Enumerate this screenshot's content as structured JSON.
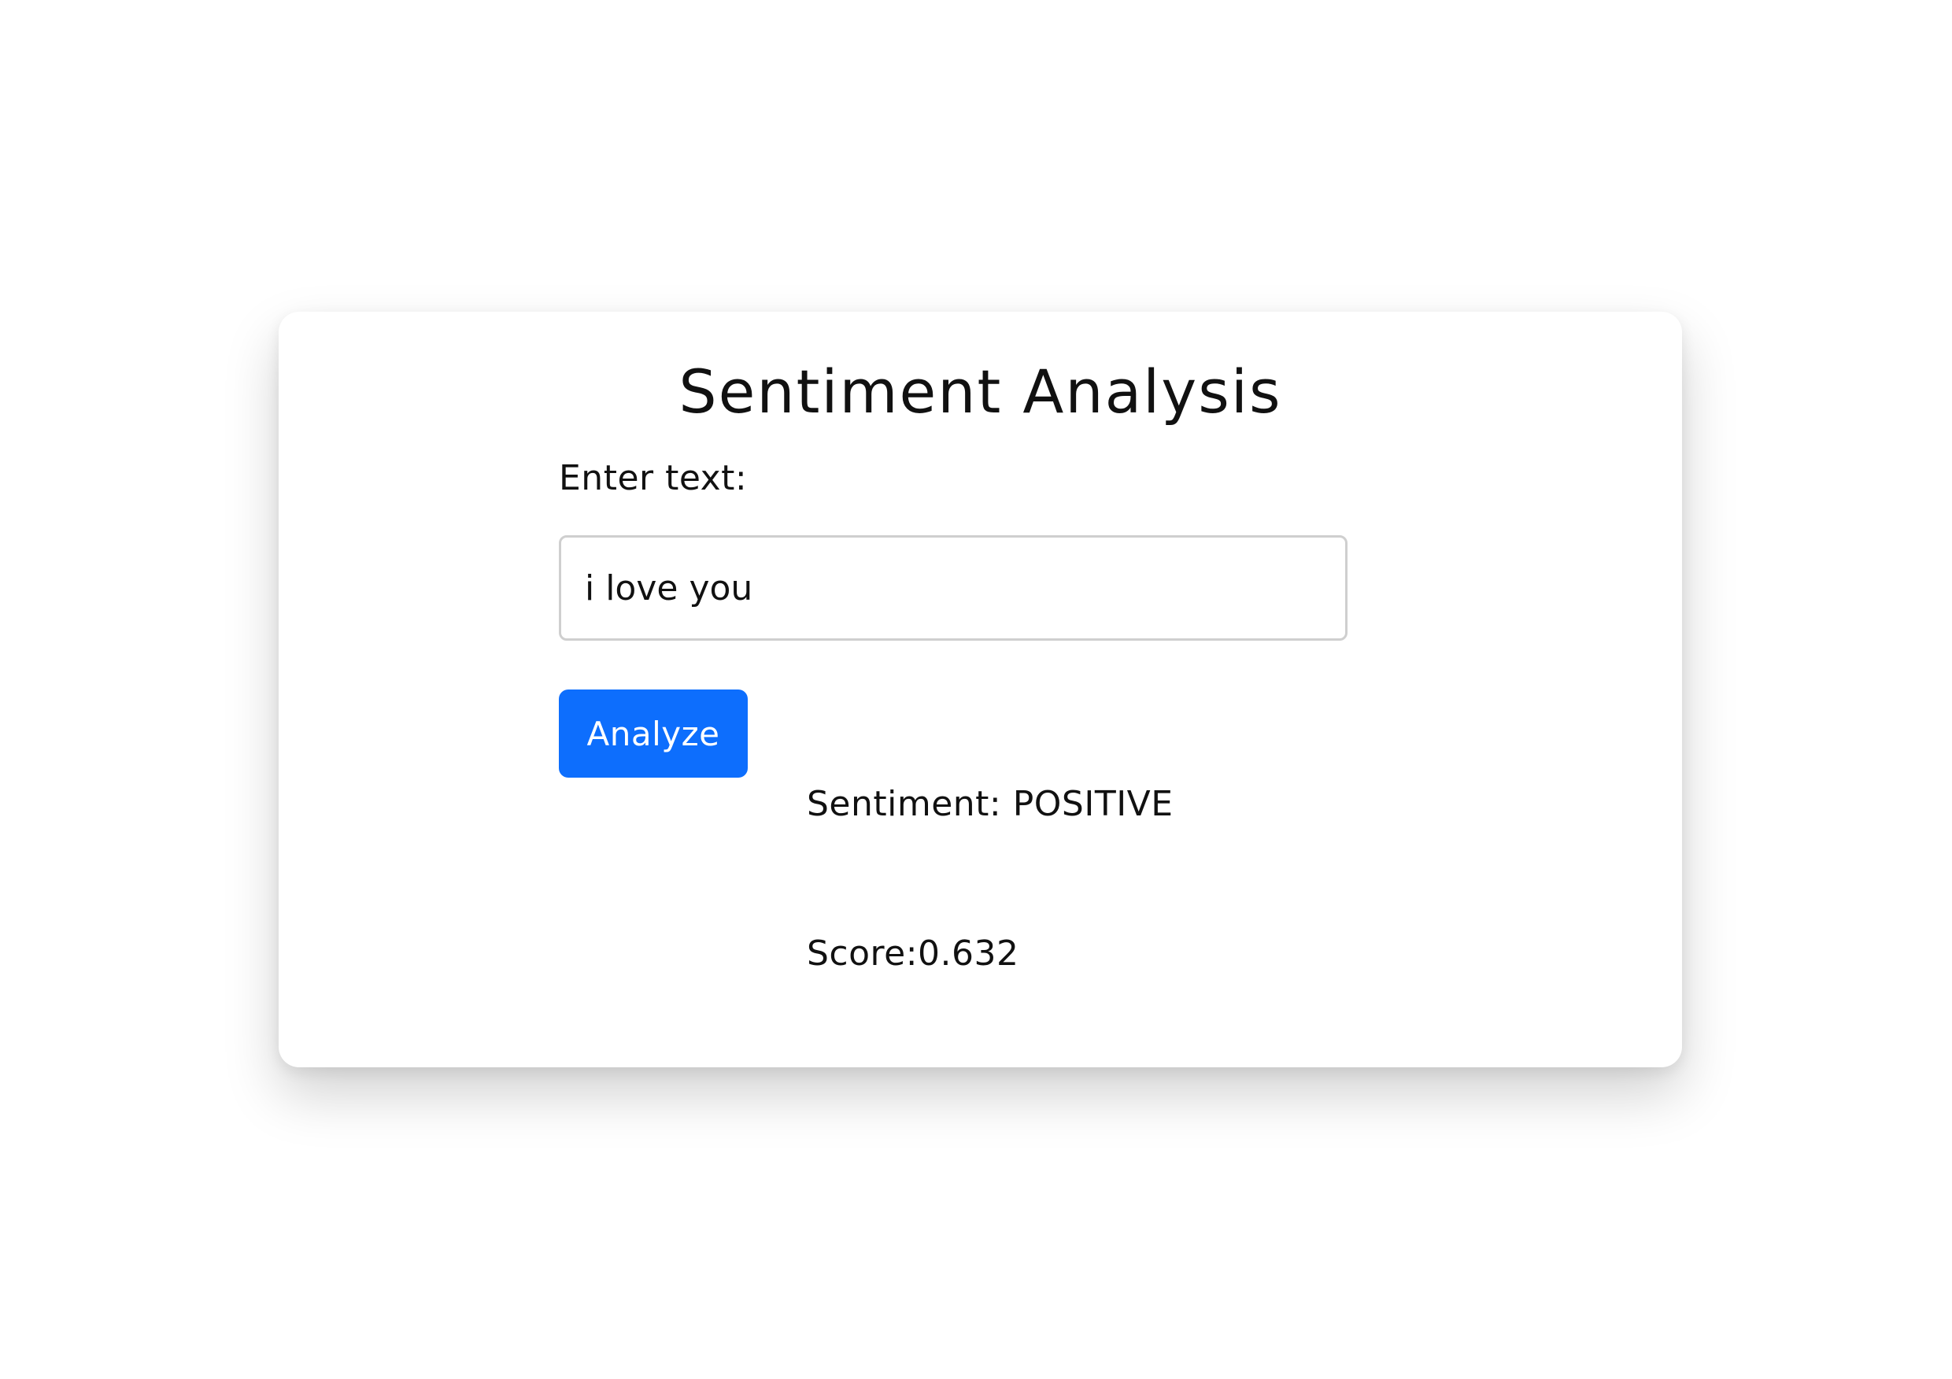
{
  "app": {
    "title": "Sentiment Analysis"
  },
  "form": {
    "label": "Enter text:",
    "input_value": "i love you",
    "submit_label": "Analyze"
  },
  "result": {
    "sentiment_text": "Sentiment: POSITIVE",
    "score_text": "Score:0.632"
  },
  "colors": {
    "accent": "#0d6efd",
    "background": "#ffffff",
    "input_border": "#cfcfcf"
  }
}
